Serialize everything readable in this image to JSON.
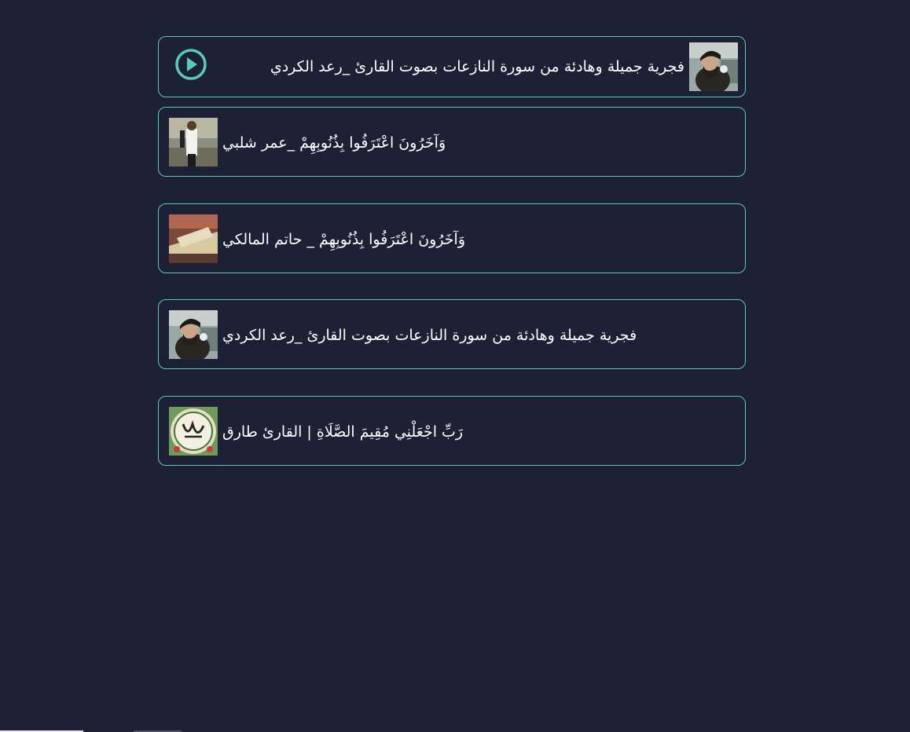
{
  "now_playing": {
    "title": "فجرية جميلة وهادئة من سورة النازعات بصوت القارئ _رعد الكردي",
    "play_icon": "play-circle-icon",
    "accent_color": "#58cbbd"
  },
  "tracks": [
    {
      "title": "وَآخَرُونَ اعْتَرَفُوا بِذُنُوبِهِمْ _عمر شلبي"
    },
    {
      "title": "وَآخَرُونَ اعْتَرَفُوا بِذُنُوبِهِمْ _ حاتم المالكي"
    },
    {
      "title": "فجرية جميلة وهادئة من سورة النازعات بصوت القارئ _رعد الكردي"
    },
    {
      "title": "رَبِّ اجْعَلْنِي مُقِيمَ الصَّلَاةِ | القارئ طارق"
    }
  ],
  "colors": {
    "background": "#1c2136",
    "border": "#58cbbd",
    "text": "#ffffff"
  }
}
